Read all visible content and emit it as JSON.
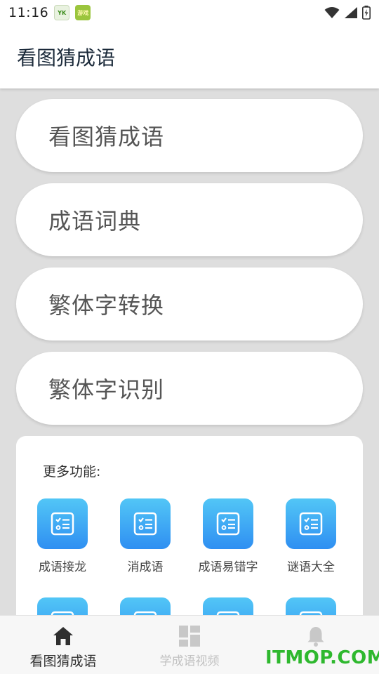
{
  "status_bar": {
    "time": "11:16",
    "app_icon_1": "YK",
    "app_icon_2": "游戏"
  },
  "app_bar": {
    "title": "看图猜成语"
  },
  "menu": [
    {
      "label": "看图猜成语"
    },
    {
      "label": "成语词典"
    },
    {
      "label": "繁体字转换"
    },
    {
      "label": "繁体字识别"
    }
  ],
  "more": {
    "title": "更多功能:",
    "tiles": [
      {
        "label": "成语接龙",
        "icon": "list-check-icon"
      },
      {
        "label": "消成语",
        "icon": "list-check-icon"
      },
      {
        "label": "成语易错字",
        "icon": "list-check-icon"
      },
      {
        "label": "谜语大全",
        "icon": "list-check-icon"
      },
      {
        "label": "",
        "icon": "list-check-icon"
      },
      {
        "label": "",
        "icon": "list-check-icon"
      },
      {
        "label": "",
        "icon": "list-check-icon"
      },
      {
        "label": "",
        "icon": "list-check-icon"
      }
    ]
  },
  "bottom_nav": {
    "items": [
      {
        "label": "看图猜成语",
        "icon": "home-icon"
      },
      {
        "label": "学成语视频",
        "icon": "dashboard-icon"
      },
      {
        "label": "",
        "icon": "bell-icon"
      }
    ]
  },
  "watermark": "ITMOP.COM",
  "colors": {
    "accent_gradient_top": "#52c6f6",
    "accent_gradient_bottom": "#2f8ff2",
    "background": "#dedede",
    "watermark": "#2eb82e"
  }
}
